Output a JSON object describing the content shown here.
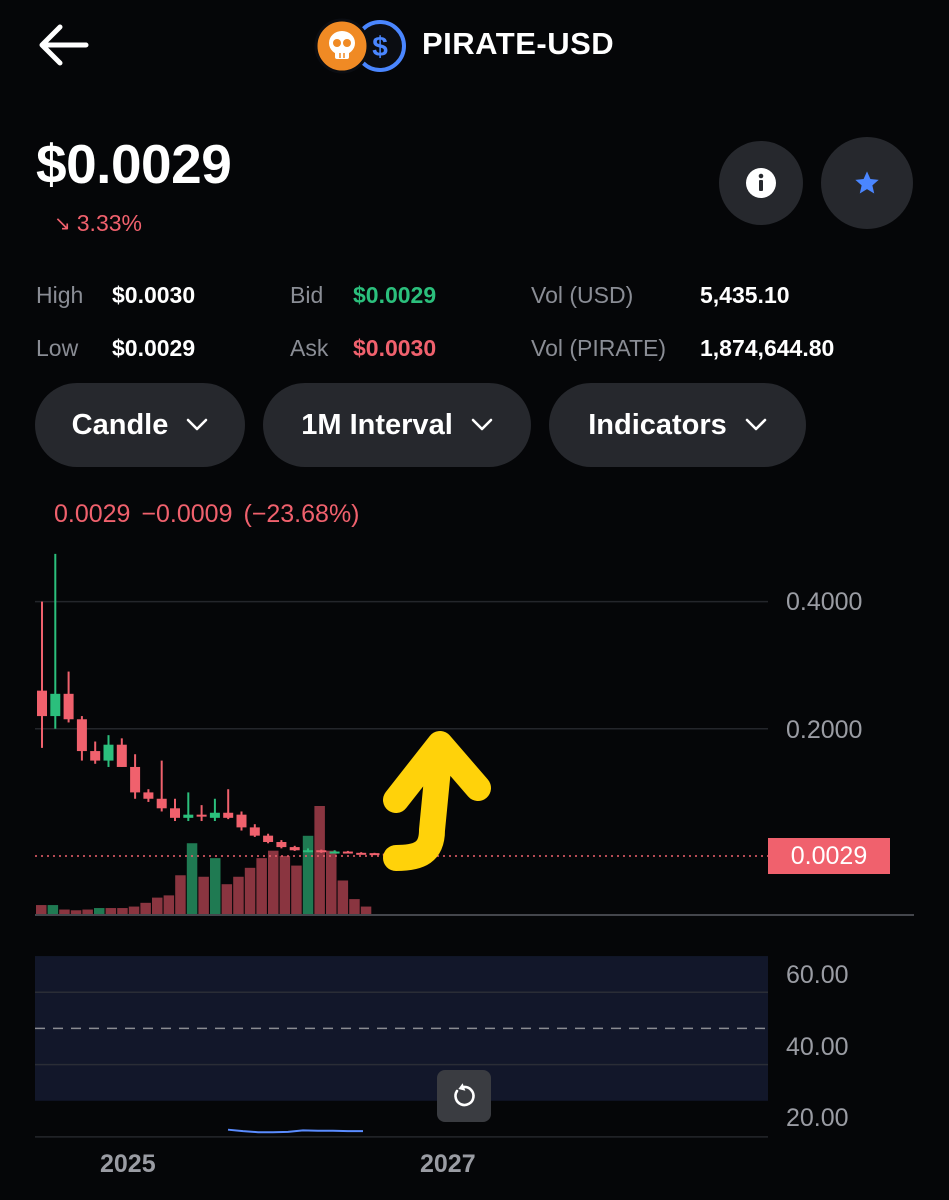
{
  "header": {
    "back_icon": "arrow-left-icon",
    "base_icon": "skull-icon",
    "quote_icon": "dollar-icon",
    "title": "PIRATE-USD"
  },
  "price": {
    "value": "$0.0029",
    "change": "3.33%",
    "change_icon": "arrow-down-right-icon"
  },
  "actions": {
    "info_icon": "info-icon",
    "star_icon": "star-icon"
  },
  "stats": {
    "high_label": "High",
    "high_value": "$0.0030",
    "low_label": "Low",
    "low_value": "$0.0029",
    "bid_label": "Bid",
    "bid_value": "$0.0029",
    "ask_label": "Ask",
    "ask_value": "$0.0030",
    "vol_usd_label": "Vol (USD)",
    "vol_usd_value": "5,435.10",
    "vol_base_label": "Vol (PIRATE)",
    "vol_base_value": "1,874,644.80"
  },
  "controls": {
    "chart_type": "Candle",
    "interval": "1M Interval",
    "indicators": "Indicators"
  },
  "chart_header": {
    "last": "0.0029",
    "change_abs": "−0.0009",
    "change_pct": "(−23.68%)"
  },
  "colors": {
    "up": "#2bbf7c",
    "down": "#f0616d",
    "accent_blue": "#4a86ff",
    "annotation_yellow": "#ffd20a"
  },
  "chart_data": {
    "type": "candlestick",
    "y_ticks": [
      "0.4000",
      "0.2000"
    ],
    "ylim": [
      0,
      0.5
    ],
    "last_price_label": "0.0029",
    "x_ticks": [
      "2025",
      "2027"
    ],
    "candles": [
      {
        "o": 0.26,
        "h": 0.4,
        "l": 0.17,
        "c": 0.22
      },
      {
        "o": 0.22,
        "h": 0.475,
        "l": 0.2,
        "c": 0.255
      },
      {
        "o": 0.255,
        "h": 0.29,
        "l": 0.21,
        "c": 0.215
      },
      {
        "o": 0.215,
        "h": 0.22,
        "l": 0.15,
        "c": 0.165
      },
      {
        "o": 0.165,
        "h": 0.18,
        "l": 0.145,
        "c": 0.15
      },
      {
        "o": 0.15,
        "h": 0.19,
        "l": 0.14,
        "c": 0.175
      },
      {
        "o": 0.175,
        "h": 0.185,
        "l": 0.14,
        "c": 0.14
      },
      {
        "o": 0.14,
        "h": 0.16,
        "l": 0.09,
        "c": 0.1
      },
      {
        "o": 0.1,
        "h": 0.105,
        "l": 0.085,
        "c": 0.09
      },
      {
        "o": 0.09,
        "h": 0.15,
        "l": 0.07,
        "c": 0.075
      },
      {
        "o": 0.075,
        "h": 0.09,
        "l": 0.055,
        "c": 0.06
      },
      {
        "o": 0.06,
        "h": 0.1,
        "l": 0.055,
        "c": 0.065
      },
      {
        "o": 0.065,
        "h": 0.08,
        "l": 0.055,
        "c": 0.062
      },
      {
        "o": 0.06,
        "h": 0.09,
        "l": 0.055,
        "c": 0.068
      },
      {
        "o": 0.068,
        "h": 0.105,
        "l": 0.058,
        "c": 0.06
      },
      {
        "o": 0.065,
        "h": 0.07,
        "l": 0.04,
        "c": 0.045
      },
      {
        "o": 0.045,
        "h": 0.05,
        "l": 0.03,
        "c": 0.032
      },
      {
        "o": 0.032,
        "h": 0.035,
        "l": 0.02,
        "c": 0.022
      },
      {
        "o": 0.022,
        "h": 0.025,
        "l": 0.012,
        "c": 0.014
      },
      {
        "o": 0.014,
        "h": 0.016,
        "l": 0.008,
        "c": 0.009
      },
      {
        "o": 0.008,
        "h": 0.012,
        "l": 0.006,
        "c": 0.009
      },
      {
        "o": 0.009,
        "h": 0.01,
        "l": 0.005,
        "c": 0.006
      },
      {
        "o": 0.006,
        "h": 0.009,
        "l": 0.005,
        "c": 0.007
      },
      {
        "o": 0.007,
        "h": 0.008,
        "l": 0.004,
        "c": 0.005
      },
      {
        "o": 0.005,
        "h": 0.006,
        "l": 0.004,
        "c": 0.0045
      },
      {
        "o": 0.0045,
        "h": 0.005,
        "l": 0.0035,
        "c": 0.004
      },
      {
        "o": 0.0038,
        "h": 0.0045,
        "l": 0.003,
        "c": 0.0029
      }
    ],
    "volume_relative": [
      0.12,
      0.12,
      0.06,
      0.05,
      0.06,
      0.08,
      0.08,
      0.08,
      0.1,
      0.15,
      0.22,
      0.25,
      0.52,
      0.95,
      0.5,
      0.75,
      0.4,
      0.5,
      0.62,
      0.75,
      0.85,
      0.78,
      0.65,
      1.05,
      1.45,
      0.85,
      0.45,
      0.2,
      0.1
    ],
    "volume_up": [
      false,
      true,
      false,
      false,
      false,
      true,
      false,
      false,
      false,
      false,
      false,
      false,
      false,
      true,
      false,
      true,
      false,
      false,
      false,
      false,
      false,
      false,
      false,
      true,
      false,
      false,
      false,
      false,
      false
    ],
    "rsi_ticks": [
      "60.00",
      "40.00",
      "20.00"
    ],
    "rsi_ylim": [
      15,
      75
    ],
    "rsi_band": [
      30,
      70
    ],
    "rsi_midline": 50,
    "rsi_values": [
      22.0,
      21.6,
      21.3,
      21.3,
      21.4,
      21.8,
      21.7,
      21.7,
      21.6,
      21.6
    ]
  },
  "reset_icon": "reset-icon"
}
